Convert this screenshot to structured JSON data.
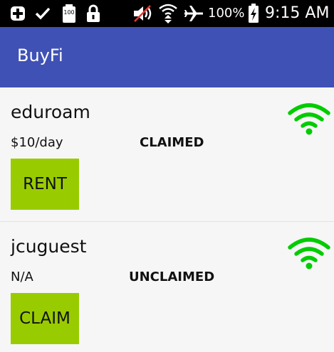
{
  "status_bar": {
    "icons": [
      "add-notification-icon",
      "check-icon",
      "storage-icon",
      "lock-icon",
      "muted-speaker-icon",
      "wifi-signal-icon",
      "airplane-icon",
      "battery-charging-icon"
    ],
    "storage_label": "100",
    "battery_percent": "100%",
    "time": "9:15 AM"
  },
  "app_bar": {
    "title": "BuyFi"
  },
  "networks": [
    {
      "ssid": "eduroam",
      "price": "$10/day",
      "status": "CLAIMED",
      "action_label": "RENT",
      "signal_color": "#00cc00"
    },
    {
      "ssid": "jcuguest",
      "price": "N/A",
      "status": "UNCLAIMED",
      "action_label": "CLAIM",
      "signal_color": "#00cc00"
    }
  ],
  "colors": {
    "app_bar": "#3f51b5",
    "button": "#99cc00",
    "wifi": "#00cc00"
  }
}
